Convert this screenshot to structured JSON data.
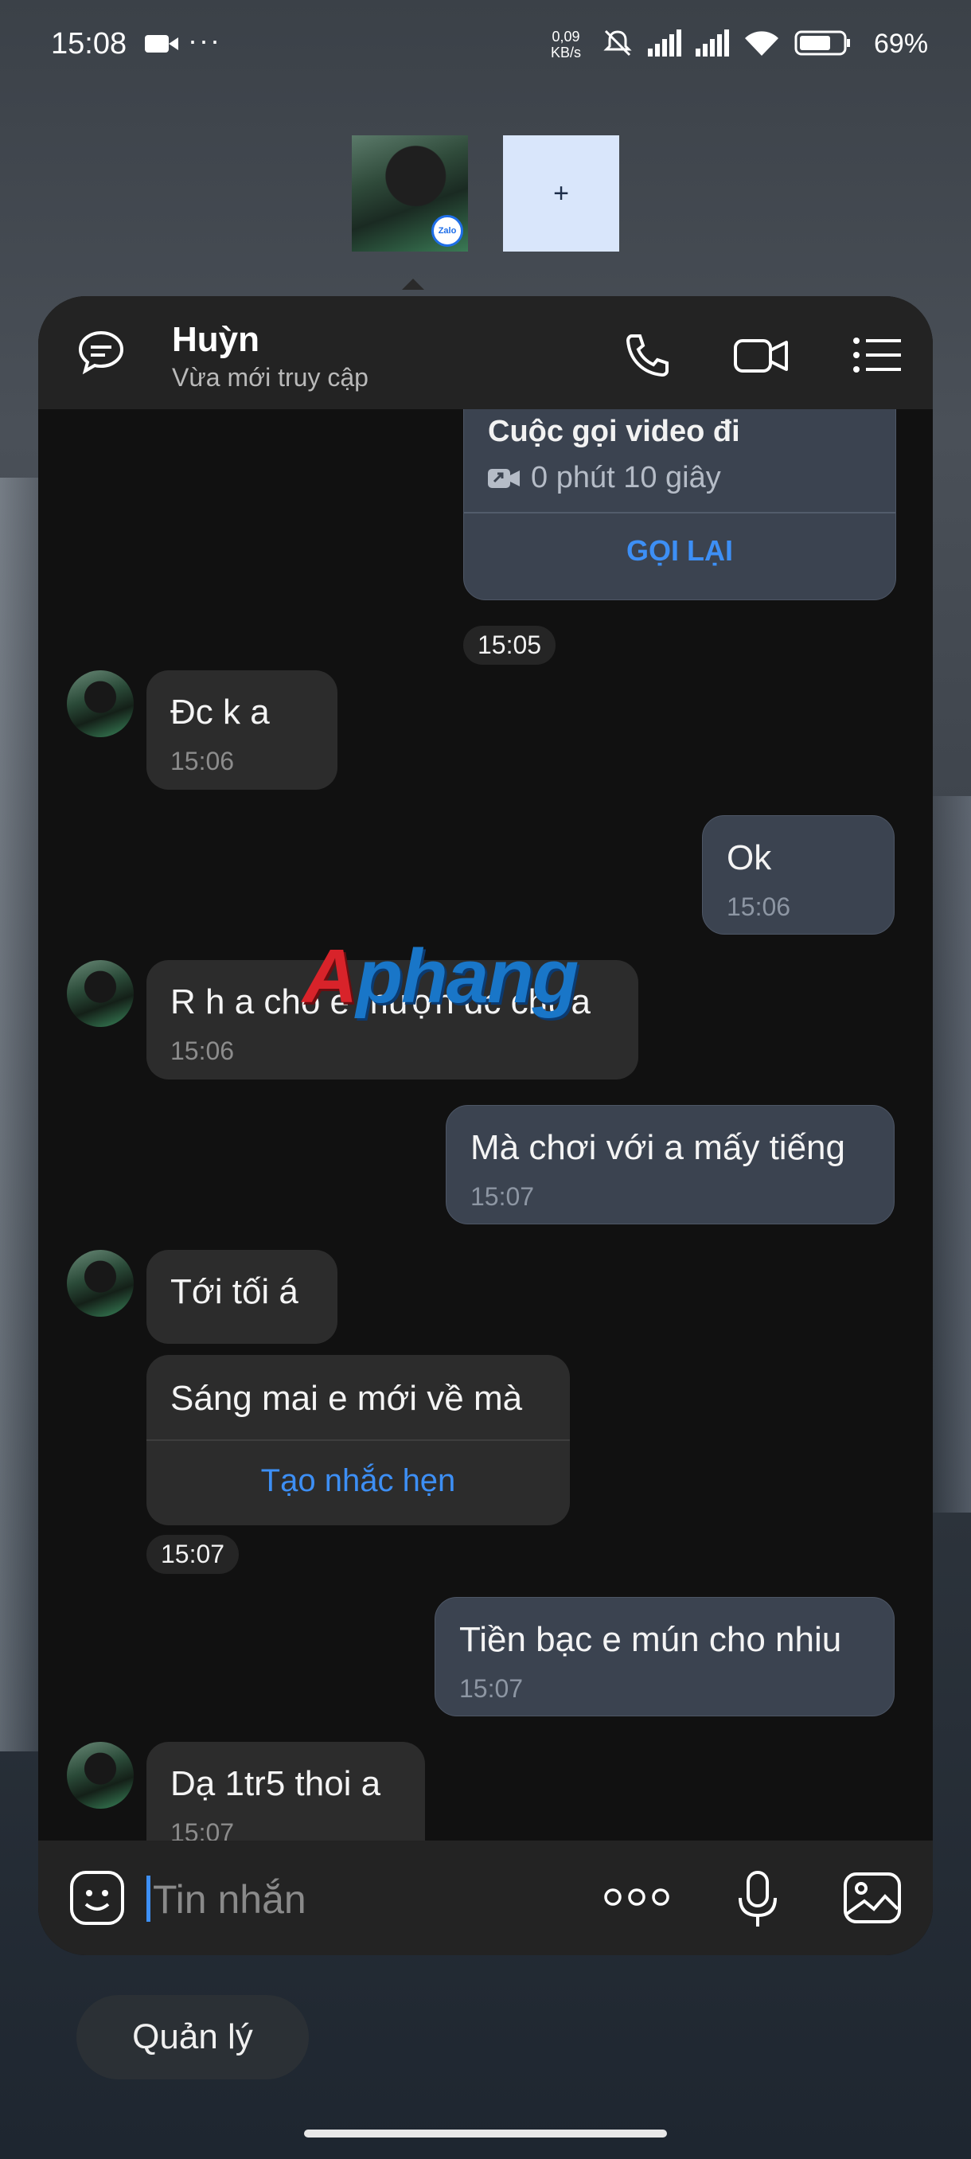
{
  "status_bar": {
    "time": "15:08",
    "dots": "···",
    "net_speed": "0,09",
    "net_unit": "KB/s",
    "battery": "69%"
  },
  "bubbles": {
    "add_label": "+",
    "zalo_badge": "Zalo"
  },
  "header": {
    "name": "Huỳn",
    "status": "Vừa mới truy cập"
  },
  "call_card": {
    "title": "Cuộc gọi video đi",
    "duration": "0 phút 10 giây",
    "action": "GỌI LẠI"
  },
  "messages": [
    {
      "direction": "time",
      "time": "15:05"
    },
    {
      "direction": "in",
      "text": "Đc k a",
      "time": "15:06"
    },
    {
      "direction": "out",
      "text": "Ok",
      "time": "15:06"
    },
    {
      "direction": "in",
      "text": "R h a cho e mượn đc chưa",
      "time": "15:06"
    },
    {
      "direction": "out",
      "text": "Mà chơi với a mấy tiếng",
      "time": "15:07"
    },
    {
      "direction": "in",
      "text": "Tới tối á"
    },
    {
      "direction": "in",
      "text": "Sáng mai e mới về mà",
      "action": "Tạo nhắc hẹn"
    },
    {
      "direction": "time",
      "time": "15:07"
    },
    {
      "direction": "out",
      "text": "Tiền bạc e mún cho nhiu",
      "time": "15:07"
    },
    {
      "direction": "in",
      "text": "Dạ 1tr5 thoi a",
      "time": "15:07"
    }
  ],
  "watermark": {
    "first": "A",
    "rest": "phang"
  },
  "composer": {
    "placeholder": "Tin nhắn"
  },
  "manage_button": "Quản lý",
  "colors": {
    "accent": "#3d8ff5",
    "incoming_bubble": "#2c2c2c",
    "outgoing_bubble": "#3b4350",
    "chat_bg": "#111111"
  }
}
